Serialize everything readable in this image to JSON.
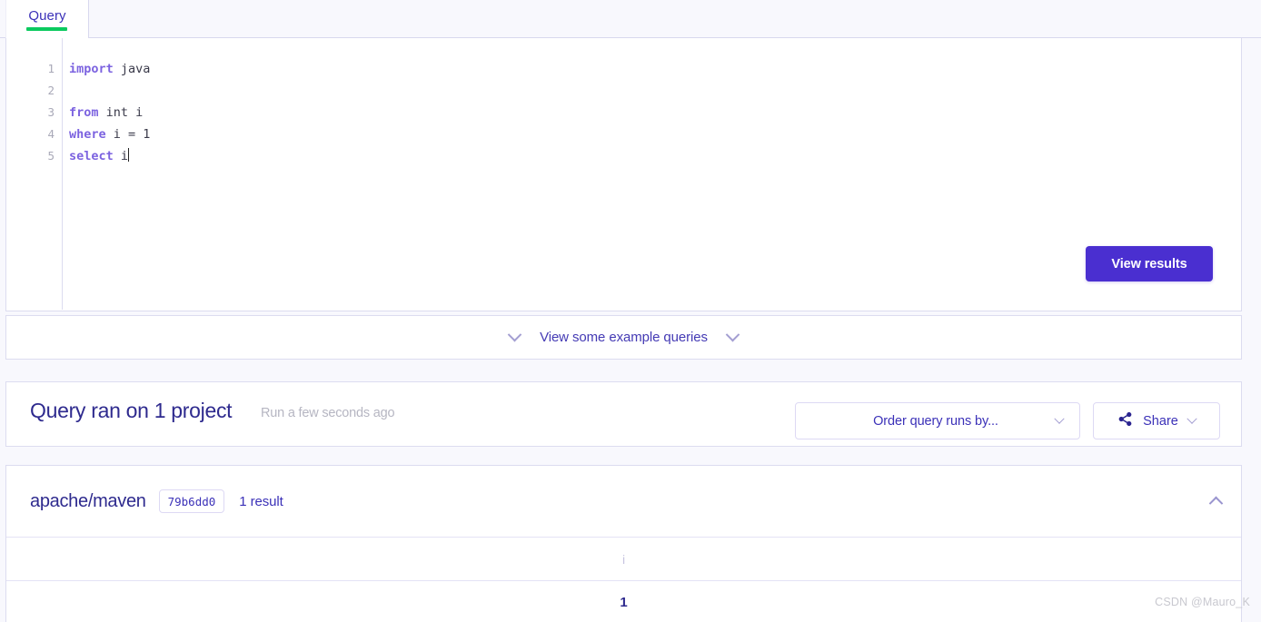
{
  "tabs": [
    {
      "label": "Query",
      "active": true
    }
  ],
  "editor": {
    "lines": [
      {
        "number": "1",
        "keyword": "import",
        "rest": " java"
      },
      {
        "number": "2",
        "keyword": "",
        "rest": ""
      },
      {
        "number": "3",
        "keyword": "from",
        "rest": " int i"
      },
      {
        "number": "4",
        "keyword": "where",
        "rest": " i = 1"
      },
      {
        "number": "5",
        "keyword": "select",
        "rest": " i"
      }
    ],
    "language": "ql",
    "caret_line": 5
  },
  "actions": {
    "view_results_label": "View results"
  },
  "examples": {
    "label": "View some example queries",
    "left_icon": "chevron-down-icon",
    "right_icon": "chevron-down-icon"
  },
  "run_info": {
    "title": "Query ran on 1 project",
    "timestamp": "Run a few seconds ago",
    "order_select_label": "Order query runs by...",
    "order_select_icon": "chevron-down-icon",
    "share_label": "Share",
    "share_icon": "share-nodes-icon",
    "share_chevron_icon": "chevron-down-icon"
  },
  "results": {
    "repo": "apache/maven",
    "sha": "79b6dd0",
    "count_label": "1 result",
    "collapse_icon": "chevron-up-icon",
    "table": {
      "headers": [
        "i"
      ],
      "rows": [
        [
          "1"
        ]
      ]
    }
  },
  "watermark": "CSDN @Mauro_K",
  "colors": {
    "page_bg": "#f8f8fd",
    "panel_bg": "#ffffff",
    "panel_border": "#dcdcf0",
    "accent_purple": "#4a2fd0",
    "link_purple": "#3b31b8",
    "heading_navy": "#2e2a8e",
    "tab_underline_green": "#0bca5f",
    "keyword_violet": "#7c63e0",
    "muted_gray": "#b6b6c2"
  }
}
